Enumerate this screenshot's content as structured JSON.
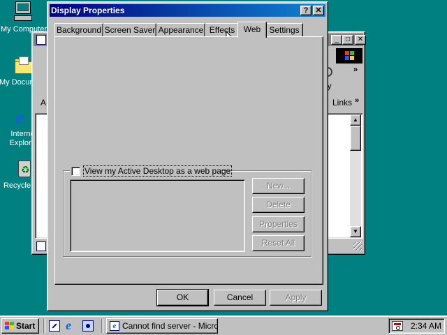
{
  "desktop": {
    "icons": [
      {
        "label": "My Computer",
        "icon": "computer-icon"
      },
      {
        "label": "My Documents",
        "icon": "folder-icon"
      },
      {
        "label": "Internet Explorer",
        "icon": "ie-icon"
      },
      {
        "label": "Recycle Bin",
        "icon": "recycle-bin-icon"
      }
    ]
  },
  "background_window": {
    "toolbar_text": "ory",
    "address_label": "A",
    "links_label": "Links"
  },
  "dialog": {
    "title": "Display Properties",
    "help_btn": "?",
    "close_btn": "✕",
    "tabs": [
      "Background",
      "Screen Saver",
      "Appearance",
      "Effects",
      "Web",
      "Settings"
    ],
    "active_tab": "Web",
    "web": {
      "checkbox_label": "View my Active Desktop as a web page",
      "checkbox_checked": false,
      "buttons": [
        "New...",
        "Delete",
        "Properties",
        "Reset All"
      ]
    },
    "footer": {
      "ok": "OK",
      "cancel": "Cancel",
      "apply": "Apply"
    }
  },
  "taskbar": {
    "start_label": "Start",
    "quicklaunch_icons": [
      "show-desktop-icon",
      "ie-icon",
      "channels-icon"
    ],
    "task_label": "Cannot find server - Micros...",
    "tray_icon": "scheduler-icon",
    "clock": "2:34 AM"
  },
  "colors": {
    "desktop": "#008080",
    "face": "#c0c0c0",
    "title_active": "#000080",
    "title_gradient_end": "#1084d0"
  }
}
